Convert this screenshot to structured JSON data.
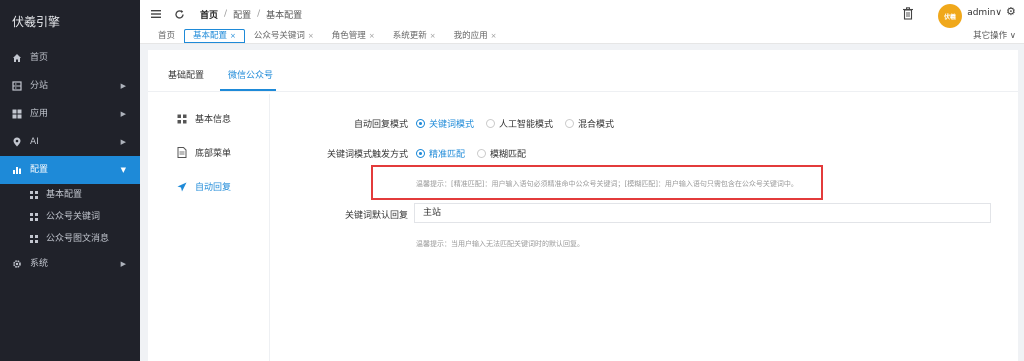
{
  "sidebar": {
    "brand": "伏羲引擎",
    "items": [
      {
        "label": "首页",
        "icon": "home-icon",
        "arrow": false,
        "active": false
      },
      {
        "label": "分站",
        "icon": "server-icon",
        "arrow": true,
        "active": false
      },
      {
        "label": "应用",
        "icon": "apps-icon",
        "arrow": true,
        "active": false
      },
      {
        "label": "AI",
        "icon": "pin-icon",
        "arrow": true,
        "active": false
      },
      {
        "label": "配置",
        "icon": "bar-chart-icon",
        "arrow": true,
        "active": true
      },
      {
        "label": "系统",
        "icon": "gear-icon",
        "arrow": true,
        "active": false
      }
    ],
    "sub_items": [
      {
        "label": "基本配置"
      },
      {
        "label": "公众号关键词"
      },
      {
        "label": "公众号图文消息"
      }
    ]
  },
  "header": {
    "breadcrumb": [
      "首页",
      "配置",
      "基本配置"
    ],
    "avatar_text": "伏羲",
    "user": "admin",
    "user_arrow": "∨"
  },
  "tabs": [
    {
      "label": "首页",
      "closable": false,
      "active": false
    },
    {
      "label": "基本配置",
      "closable": true,
      "active": true
    },
    {
      "label": "公众号关键词",
      "closable": true,
      "active": false
    },
    {
      "label": "角色管理",
      "closable": true,
      "active": false
    },
    {
      "label": "系统更新",
      "closable": true,
      "active": false
    },
    {
      "label": "我的应用",
      "closable": true,
      "active": false
    }
  ],
  "tab_close": "×",
  "others_label": "其它操作 ∨",
  "panel_tabs": [
    "基础配置",
    "微信公众号"
  ],
  "left_nav": [
    {
      "label": "基本信息",
      "icon": "grid-icon"
    },
    {
      "label": "底部菜单",
      "icon": "document-icon"
    },
    {
      "label": "自动回复",
      "icon": "send-icon"
    }
  ],
  "form": {
    "reply_mode": {
      "label": "自动回复模式",
      "options": [
        "关键词模式",
        "人工智能模式",
        "混合模式"
      ],
      "selected": 0
    },
    "trigger_mode": {
      "label": "关键词模式触发方式",
      "options": [
        "精准匹配",
        "模糊匹配"
      ],
      "selected": 0
    },
    "trigger_hint": "温馨提示：[精准匹配]：用户输入语句必须精准命中公众号关键词；[模糊匹配]：用户输入语句只需包含在公众号关键词中。",
    "default_reply": {
      "label": "关键词默认回复",
      "value": "主站"
    },
    "default_hint": "温馨提示：当用户输入无法匹配关键词时的默认回复。"
  },
  "colors": {
    "accent": "#1e8ad8",
    "sidebar_bg": "#20222a",
    "highlight_box": "#e33b3b"
  }
}
